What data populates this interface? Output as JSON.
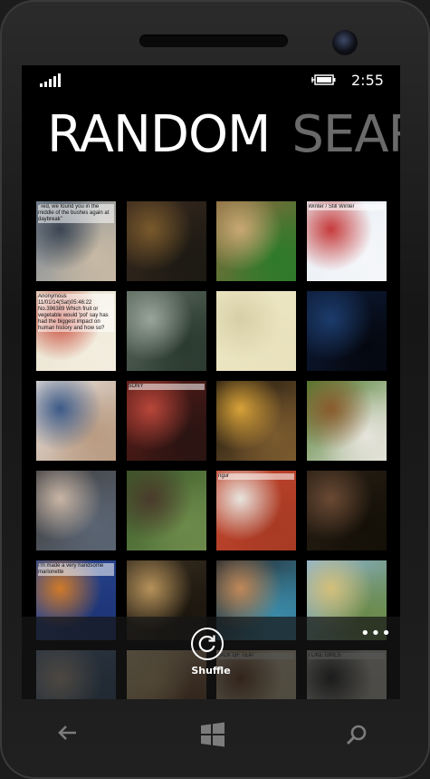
{
  "status": {
    "time": "2:55"
  },
  "header": {
    "pivot_active": "RANDOM",
    "pivot_next": "SEAR"
  },
  "app_bar": {
    "shuffle_label": "Shuffle",
    "more": "•••"
  },
  "tiles": [
    {
      "caption": "\"Ted, we found you in the middle of the bushes again at daybreak\"",
      "colors": [
        "#7a8896",
        "#3b4552",
        "#c7b9a4"
      ]
    },
    {
      "caption": "",
      "colors": [
        "#3a2a1e",
        "#7a5a2c",
        "#1d1a14"
      ]
    },
    {
      "caption": "",
      "colors": [
        "#8a6a40",
        "#c9a874",
        "#2e7a2a"
      ]
    },
    {
      "caption": "Winter / Still Winter",
      "colors": [
        "#e8eef4",
        "#c63a3a",
        "#f4f6f9"
      ]
    },
    {
      "caption": "Anonymous 11/01/14(Sat)05:46:22 No.396389 Which fruit or vegetable would 'pol' say has had the biggest impact on human history and how so?",
      "colors": [
        "#e9e3d0",
        "#c84434",
        "#f2edde"
      ]
    },
    {
      "caption": "",
      "colors": [
        "#5c6a5e",
        "#9aa59a",
        "#2b3a30"
      ]
    },
    {
      "caption": "",
      "colors": [
        "#ede7c4",
        "#d7cfa6",
        "#e9e2bd"
      ]
    },
    {
      "caption": "",
      "colors": [
        "#0e1d3a",
        "#1c3c6c",
        "#050810"
      ]
    },
    {
      "caption": "",
      "colors": [
        "#e7e2de",
        "#3c5a88",
        "#b99b82"
      ]
    },
    {
      "caption": "SONY",
      "colors": [
        "#5a1c18",
        "#b8463a",
        "#2a1412"
      ]
    },
    {
      "caption": "",
      "colors": [
        "#1a140e",
        "#d8a238",
        "#7a5a2e"
      ]
    },
    {
      "caption": "",
      "colors": [
        "#4a7a2c",
        "#8a5a2c",
        "#e6e4dc"
      ]
    },
    {
      "caption": "",
      "colors": [
        "#3e3e40",
        "#c9b6a6",
        "#5a6472"
      ]
    },
    {
      "caption": "",
      "colors": [
        "#3a5a2a",
        "#4a3a2a",
        "#6c8a4a"
      ]
    },
    {
      "caption": "ngur",
      "colors": [
        "#c4472e",
        "#e8e4de",
        "#a83a24"
      ]
    },
    {
      "caption": "",
      "colors": [
        "#2a2016",
        "#6a4a34",
        "#141008"
      ]
    },
    {
      "caption": "I'm made a very handsome marionette",
      "colors": [
        "#2c4a9a",
        "#d07a28",
        "#1e3678"
      ]
    },
    {
      "caption": "",
      "colors": [
        "#3a3022",
        "#b6925a",
        "#1c160e"
      ]
    },
    {
      "caption": "",
      "colors": [
        "#22262a",
        "#c08858",
        "#3a8aa8"
      ]
    },
    {
      "caption": "",
      "colors": [
        "#8ab4d8",
        "#d4c07a",
        "#6a8a4a"
      ]
    },
    {
      "caption": "",
      "colors": [
        "#6a8ab0",
        "#dbc8b4",
        "#3a5a7a"
      ]
    },
    {
      "caption": "",
      "colors": [
        "#f0d9a8",
        "#e8c98a",
        "#7a4a2a"
      ]
    },
    {
      "caption": "SICK OF TEA!",
      "colors": [
        "#f0e4c6",
        "#7a4a2a",
        "#e6d4a8"
      ]
    },
    {
      "caption": "I LIKE GIRLS",
      "colors": [
        "#e8e6dc",
        "#2a2a2a",
        "#d4d0c0"
      ]
    }
  ]
}
